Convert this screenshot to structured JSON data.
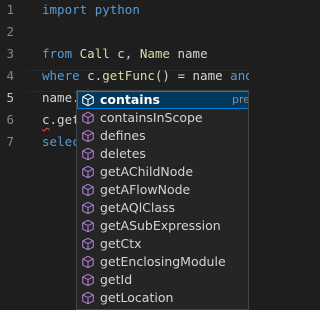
{
  "editor": {
    "lines": [
      {
        "number": "1",
        "segments": [
          {
            "t": "import ",
            "c": "kw"
          },
          {
            "t": "python",
            "c": "kw"
          }
        ]
      },
      {
        "number": "2",
        "segments": []
      },
      {
        "number": "3",
        "segments": [
          {
            "t": "from ",
            "c": "kw"
          },
          {
            "t": "Call",
            "c": "fn"
          },
          {
            "t": " c, ",
            "c": "txt"
          },
          {
            "t": "Name",
            "c": "fn"
          },
          {
            "t": " name",
            "c": "txt"
          }
        ]
      },
      {
        "number": "4",
        "segments": [
          {
            "t": "where ",
            "c": "kw"
          },
          {
            "t": "c.",
            "c": "txt"
          },
          {
            "t": "getFunc",
            "c": "fn"
          },
          {
            "t": "() = name ",
            "c": "txt"
          },
          {
            "t": "and",
            "c": "kw"
          }
        ]
      },
      {
        "number": "5",
        "segments": [
          {
            "t": "name.",
            "c": "txt"
          }
        ]
      },
      {
        "number": "6",
        "segments": [
          {
            "t": "c.get",
            "c": "txt"
          }
        ]
      },
      {
        "number": "7",
        "segments": [
          {
            "t": "selec",
            "c": "kw"
          }
        ]
      }
    ]
  },
  "suggest": {
    "typed_prefix": "",
    "items": [
      {
        "label": "contains",
        "detail": "pre",
        "icon": "method-cube-icon",
        "selected": true
      },
      {
        "label": "containsInScope",
        "icon": "method-cube-icon"
      },
      {
        "label": "defines",
        "icon": "method-cube-icon"
      },
      {
        "label": "deletes",
        "icon": "method-cube-icon"
      },
      {
        "label": "getAChildNode",
        "icon": "method-cube-icon"
      },
      {
        "label": "getAFlowNode",
        "icon": "method-cube-icon"
      },
      {
        "label": "getAQlClass",
        "icon": "method-cube-icon"
      },
      {
        "label": "getASubExpression",
        "icon": "method-cube-icon"
      },
      {
        "label": "getCtx",
        "icon": "method-cube-icon"
      },
      {
        "label": "getEnclosingModule",
        "icon": "method-cube-icon"
      },
      {
        "label": "getId",
        "icon": "method-cube-icon"
      },
      {
        "label": "getLocation",
        "icon": "method-cube-icon"
      }
    ]
  },
  "colors": {
    "background": "#1e1e1e",
    "keyword": "#569cd6",
    "function": "#dcdcaa",
    "selection": "#04395e",
    "icon": "#b180d7"
  }
}
